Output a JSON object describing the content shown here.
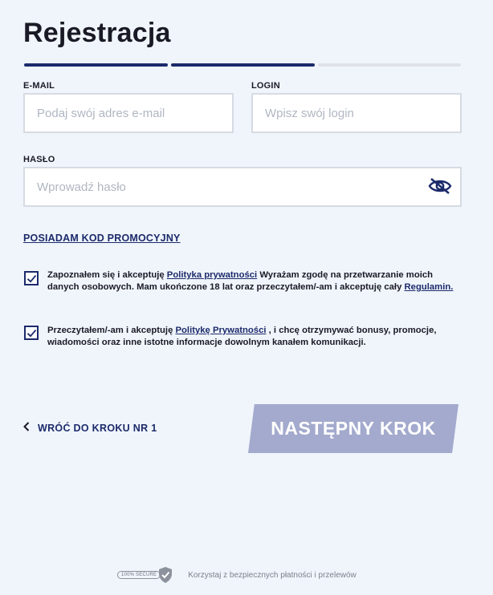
{
  "title": "Rejestracja",
  "fields": {
    "email": {
      "label": "E-MAIL",
      "placeholder": "Podaj swój adres e-mail"
    },
    "login": {
      "label": "LOGIN",
      "placeholder": "Wpisz swój login"
    },
    "password": {
      "label": "HASŁO",
      "placeholder": "Wprowadź hasło"
    }
  },
  "promo_link": "POSIADAM KOD PROMOCYJNY",
  "consent1": {
    "checked": true,
    "text_before": "Zapoznałem się i akceptuję ",
    "link1": "Polityka prywatności",
    "text_middle": " Wyrażam zgodę na przetwarzanie moich danych osobowych. Mam ukończone 18 lat oraz przeczytałem/-am i akceptuję cały ",
    "link2": "Regulamin."
  },
  "consent2": {
    "checked": true,
    "text_before": "Przeczytałem/-am i akceptuję ",
    "link1": "Politykę Prywatności",
    "text_after": " , i chcę otrzymywać bonusy, promocje, wiadomości oraz inne istotne informacje dowolnym kanałem komunikacji."
  },
  "back_label": "WRÓĆ DO KROKU NR 1",
  "next_label": "NASTĘPNY KROK",
  "footer": {
    "badge": "100% SECURE",
    "text": "Korzystaj z bezpiecznych płatności i przelewów"
  },
  "colors": {
    "background": "#f0f5fb",
    "primary": "#1c2a6b",
    "button_disabled": "#a3aacd"
  },
  "progress": {
    "steps_total": 3,
    "steps_completed": 2
  }
}
